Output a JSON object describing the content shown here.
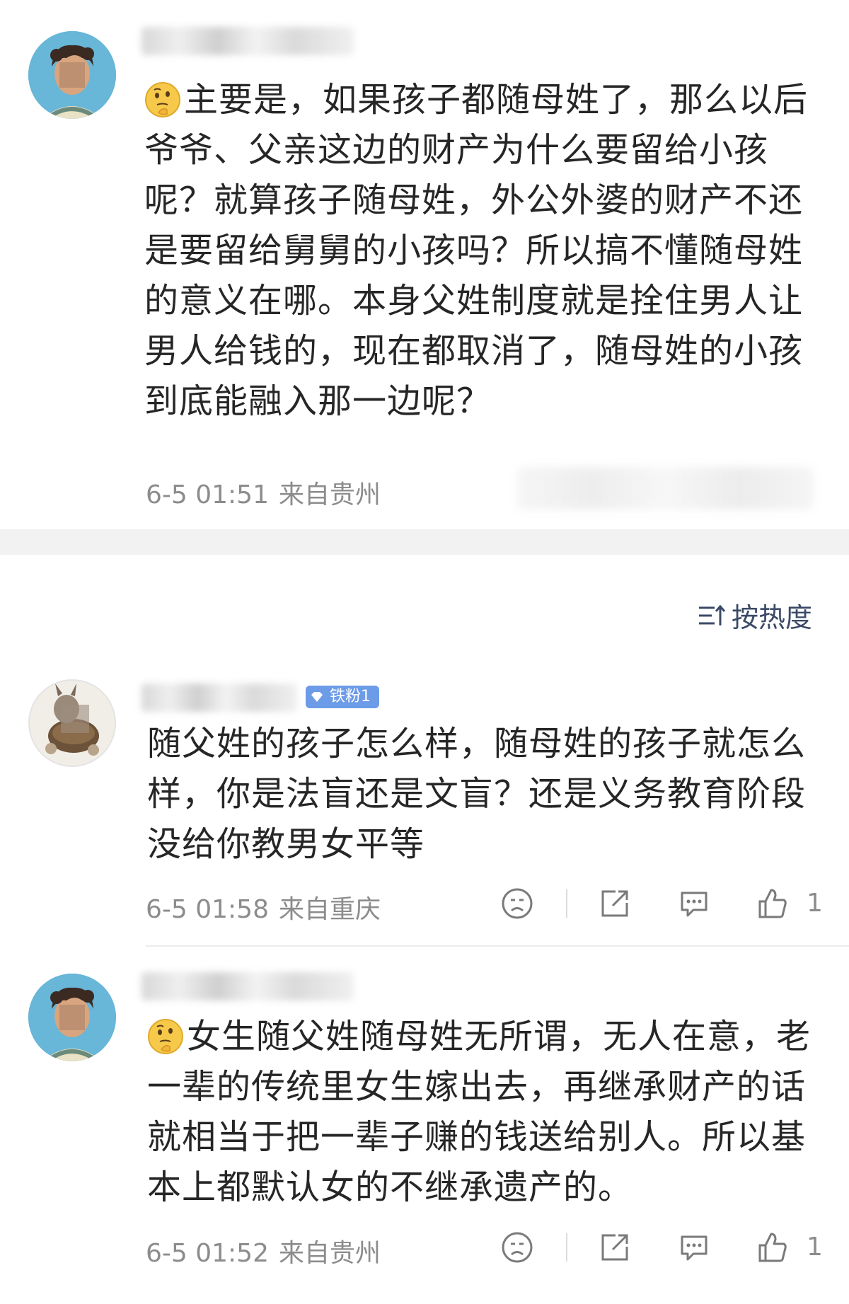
{
  "comments": [
    {
      "avatar": "cartoon-boy-avatar",
      "has_emoji": true,
      "emoji": "thinking-face",
      "text": "主要是，如果孩子都随母姓了，那么以后爷爷、父亲这边的财产为什么要留给小孩呢？就算孩子随母姓，外公外婆的财产不还是要留给舅舅的小孩吗？所以搞不懂随母姓的意义在哪。本身父姓制度就是拴住男人让男人给钱的，现在都取消了，随母姓的小孩到底能融入那一边呢？",
      "time": "6-5 01:51",
      "location": "来自贵州"
    }
  ],
  "sort": {
    "icon": "sort-lines-icon",
    "label": "按热度"
  },
  "replies": [
    {
      "avatar": "animal-avatar",
      "badge": "铁粉1",
      "text": "随父姓的孩子怎么样，随母姓的孩子就怎么样，你是法盲还是文盲？还是义务教育阶段没给你教男女平等",
      "time": "6-5 01:58",
      "location": "来自重庆",
      "like_count": "1"
    },
    {
      "avatar": "cartoon-boy-avatar",
      "emoji": "thinking-face",
      "text": "女生随父姓随母姓无所谓，无人在意，老一辈的传统里女生嫁出去，再继承财产的话就相当于把一辈子赚的钱送给别人。所以基本上都默认女的不继承遗产的。",
      "time": "6-5 01:52",
      "location": "来自贵州",
      "like_count": "1"
    }
  ],
  "actions": {
    "dislike_icon": "sad-face-icon",
    "share_icon": "share-icon",
    "comment_icon": "comment-bubble-icon",
    "like_icon": "thumbs-up-icon"
  },
  "colors": {
    "text": "#262626",
    "meta": "#8c8c8c",
    "sort": "#3b4a66",
    "badge": "#6c9be8",
    "band": "#f2f2f2"
  }
}
